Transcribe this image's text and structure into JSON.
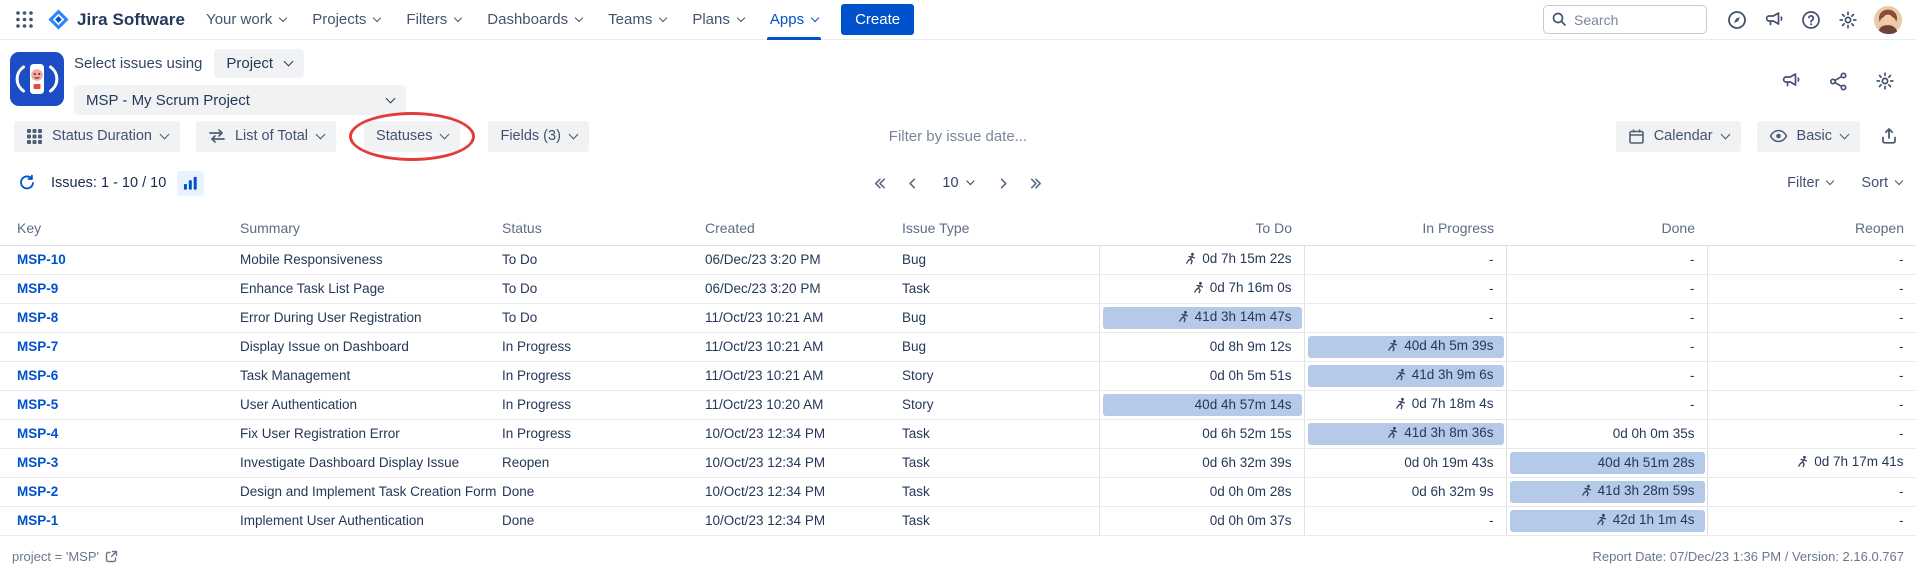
{
  "topnav": {
    "brand": "Jira Software",
    "items": [
      "Your work",
      "Projects",
      "Filters",
      "Dashboards",
      "Teams",
      "Plans",
      "Apps"
    ],
    "active_item": "Apps",
    "create_label": "Create",
    "search_placeholder": "Search"
  },
  "app_header": {
    "select_issues_label": "Select issues using",
    "issue_source": "Project",
    "project_name": "MSP - My Scrum Project"
  },
  "toolbar": {
    "report_type": "Status Duration",
    "list_mode": "List of Total",
    "statuses": "Statuses",
    "fields": "Fields (3)",
    "date_filter_placeholder": "Filter by issue date...",
    "calendar": "Calendar",
    "view_mode": "Basic"
  },
  "issues_bar": {
    "issues_count": "Issues: 1 - 10 / 10",
    "page_size": "10",
    "filter": "Filter",
    "sort": "Sort"
  },
  "table": {
    "columns": [
      "Key",
      "Summary",
      "Status",
      "Created",
      "Issue Type",
      "To Do",
      "In Progress",
      "Done",
      "Reopen"
    ],
    "rows": [
      {
        "key": "MSP-10",
        "summary": "Mobile Responsiveness",
        "status": "To Do",
        "created": "06/Dec/23 3:20 PM",
        "type": "Bug",
        "durations": [
          {
            "text": "0d 7h 15m 22s",
            "runner": true,
            "bar": false
          },
          {
            "text": "-",
            "runner": false,
            "bar": false
          },
          {
            "text": "-",
            "runner": false,
            "bar": false
          },
          {
            "text": "-",
            "runner": false,
            "bar": false
          }
        ]
      },
      {
        "key": "MSP-9",
        "summary": "Enhance Task List Page",
        "status": "To Do",
        "created": "06/Dec/23 3:20 PM",
        "type": "Task",
        "durations": [
          {
            "text": "0d 7h 16m 0s",
            "runner": true,
            "bar": false
          },
          {
            "text": "-",
            "runner": false,
            "bar": false
          },
          {
            "text": "-",
            "runner": false,
            "bar": false
          },
          {
            "text": "-",
            "runner": false,
            "bar": false
          }
        ]
      },
      {
        "key": "MSP-8",
        "summary": "Error During User Registration",
        "status": "To Do",
        "created": "11/Oct/23 10:21 AM",
        "type": "Bug",
        "durations": [
          {
            "text": "41d 3h 14m 47s",
            "runner": true,
            "bar": true
          },
          {
            "text": "-",
            "runner": false,
            "bar": false
          },
          {
            "text": "-",
            "runner": false,
            "bar": false
          },
          {
            "text": "-",
            "runner": false,
            "bar": false
          }
        ]
      },
      {
        "key": "MSP-7",
        "summary": "Display Issue on Dashboard",
        "status": "In Progress",
        "created": "11/Oct/23 10:21 AM",
        "type": "Bug",
        "durations": [
          {
            "text": "0d 8h 9m 12s",
            "runner": false,
            "bar": false
          },
          {
            "text": "40d 4h 5m 39s",
            "runner": true,
            "bar": true
          },
          {
            "text": "-",
            "runner": false,
            "bar": false
          },
          {
            "text": "-",
            "runner": false,
            "bar": false
          }
        ]
      },
      {
        "key": "MSP-6",
        "summary": "Task Management",
        "status": "In Progress",
        "created": "11/Oct/23 10:21 AM",
        "type": "Story",
        "durations": [
          {
            "text": "0d 0h 5m 51s",
            "runner": false,
            "bar": false
          },
          {
            "text": "41d 3h 9m 6s",
            "runner": true,
            "bar": true
          },
          {
            "text": "-",
            "runner": false,
            "bar": false
          },
          {
            "text": "-",
            "runner": false,
            "bar": false
          }
        ]
      },
      {
        "key": "MSP-5",
        "summary": "User Authentication",
        "status": "In Progress",
        "created": "11/Oct/23 10:20 AM",
        "type": "Story",
        "durations": [
          {
            "text": "40d 4h 57m 14s",
            "runner": false,
            "bar": true
          },
          {
            "text": "0d 7h 18m 4s",
            "runner": true,
            "bar": false
          },
          {
            "text": "-",
            "runner": false,
            "bar": false
          },
          {
            "text": "-",
            "runner": false,
            "bar": false
          }
        ]
      },
      {
        "key": "MSP-4",
        "summary": "Fix User Registration Error",
        "status": "In Progress",
        "created": "10/Oct/23 12:34 PM",
        "type": "Task",
        "durations": [
          {
            "text": "0d 6h 52m 15s",
            "runner": false,
            "bar": false
          },
          {
            "text": "41d 3h 8m 36s",
            "runner": true,
            "bar": true
          },
          {
            "text": "0d 0h 0m 35s",
            "runner": false,
            "bar": false
          },
          {
            "text": "-",
            "runner": false,
            "bar": false
          }
        ]
      },
      {
        "key": "MSP-3",
        "summary": "Investigate Dashboard Display Issue",
        "status": "Reopen",
        "created": "10/Oct/23 12:34 PM",
        "type": "Task",
        "durations": [
          {
            "text": "0d 6h 32m 39s",
            "runner": false,
            "bar": false
          },
          {
            "text": "0d 0h 19m 43s",
            "runner": false,
            "bar": false
          },
          {
            "text": "40d 4h 51m 28s",
            "runner": false,
            "bar": true
          },
          {
            "text": "0d 7h 17m 41s",
            "runner": true,
            "bar": false
          }
        ]
      },
      {
        "key": "MSP-2",
        "summary": "Design and Implement Task Creation Form",
        "status": "Done",
        "created": "10/Oct/23 12:34 PM",
        "type": "Task",
        "durations": [
          {
            "text": "0d 0h 0m 28s",
            "runner": false,
            "bar": false
          },
          {
            "text": "0d 6h 32m 9s",
            "runner": false,
            "bar": false
          },
          {
            "text": "41d 3h 28m 59s",
            "runner": true,
            "bar": true
          },
          {
            "text": "-",
            "runner": false,
            "bar": false
          }
        ]
      },
      {
        "key": "MSP-1",
        "summary": "Implement User Authentication",
        "status": "Done",
        "created": "10/Oct/23 12:34 PM",
        "type": "Task",
        "durations": [
          {
            "text": "0d 0h 0m 37s",
            "runner": false,
            "bar": false
          },
          {
            "text": "-",
            "runner": false,
            "bar": false
          },
          {
            "text": "42d 1h 1m 4s",
            "runner": true,
            "bar": true
          },
          {
            "text": "-",
            "runner": false,
            "bar": false
          }
        ]
      }
    ]
  },
  "footer": {
    "jql": "project = 'MSP'",
    "report_info": "Report Date: 07/Dec/23 1:36 PM / Version: 2.16.0.767"
  },
  "colors": {
    "brand_blue": "#0052CC",
    "duration_bar": "#B5C9E8",
    "annotation_red": "#E13C3C"
  }
}
